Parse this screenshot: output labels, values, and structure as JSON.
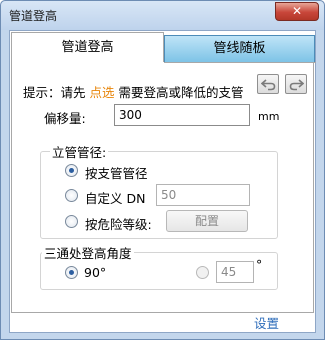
{
  "window": {
    "title": "管道登高",
    "close_label": "✕"
  },
  "tabs": [
    {
      "label": "管道登高",
      "active": true
    },
    {
      "label": "管线随板",
      "active": false
    }
  ],
  "hint": {
    "prefix": "提示：请先 ",
    "highlight": "点选",
    "suffix": " 需要登高或降低的支管"
  },
  "offset": {
    "label": "偏移量:",
    "value": "300",
    "unit": "mm"
  },
  "riser_group": {
    "title": "立管管径:",
    "options": [
      {
        "label": "按支管管径",
        "checked": true
      },
      {
        "label": "自定义 DN",
        "checked": false,
        "value": "50"
      },
      {
        "label": "按危险等级:",
        "checked": false,
        "button": "配置"
      }
    ]
  },
  "tee_group": {
    "title": "三通处登高角度",
    "option1": {
      "label": "90°",
      "checked": true
    },
    "option2": {
      "value": "45",
      "unit": "°",
      "checked": false
    }
  },
  "settings_link": "设置",
  "colors": {
    "highlight": "#e8860b",
    "link": "#2e6dba",
    "tab_inactive": "#7bc2e6",
    "title_bg": "#c3d6ec"
  }
}
